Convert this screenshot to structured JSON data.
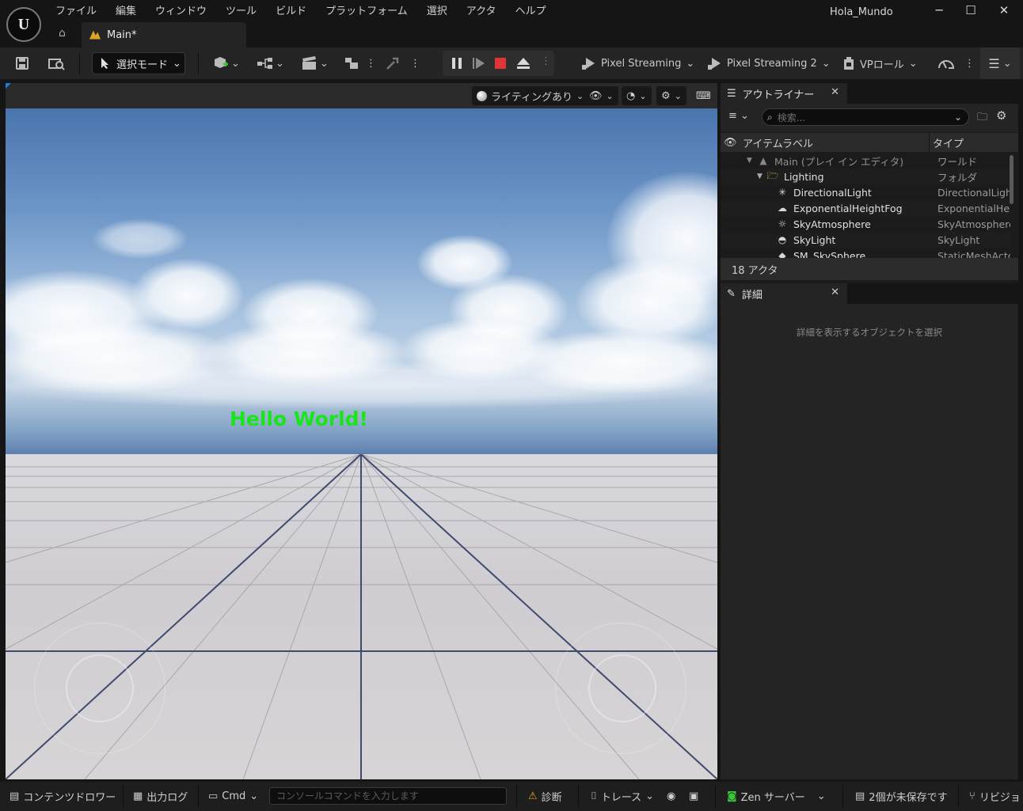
{
  "window": {
    "title": "Hola_Mundo",
    "minimize": "─",
    "maximize": "☐",
    "close": "✕"
  },
  "menu": [
    "ファイル",
    "編集",
    "ウィンドウ",
    "ツール",
    "ビルド",
    "プラットフォーム",
    "選択",
    "アクタ",
    "ヘルプ"
  ],
  "doc_tab": {
    "label": "Main*"
  },
  "toolbar": {
    "mode": "選択モード",
    "pixel_streaming": "Pixel Streaming",
    "pixel_streaming_2": "Pixel Streaming 2",
    "vp_role": "VPロール"
  },
  "viewport": {
    "lighting": "ライティングあり",
    "hello_text": "Hello World!"
  },
  "outliner": {
    "title": "アウトライナー",
    "search_placeholder": "検索...",
    "col_label": "アイテムラベル",
    "col_type": "タイプ",
    "rows": [
      {
        "name": "Main (プレイ イン エディタ)",
        "type": "ワールド",
        "icon": "level-icon"
      },
      {
        "name": "Lighting",
        "type": "フォルダ",
        "icon": "folder-icon"
      },
      {
        "name": "DirectionalLight",
        "type": "DirectionalLight",
        "icon": "directional-light-icon"
      },
      {
        "name": "ExponentialHeightFog",
        "type": "ExponentialHeig",
        "icon": "fog-icon"
      },
      {
        "name": "SkyAtmosphere",
        "type": "SkyAtmosphere",
        "icon": "sky-atmosphere-icon"
      },
      {
        "name": "SkyLight",
        "type": "SkyLight",
        "icon": "skylight-icon"
      },
      {
        "name": "SM_SkySphere",
        "type": "StaticMeshActo",
        "icon": "static-mesh-icon"
      }
    ],
    "count": "18 アクタ"
  },
  "details": {
    "title": "詳細",
    "empty_message": "詳細を表示するオブジェクトを選択"
  },
  "statusbar": {
    "content_drawer": "コンテンツドロワー",
    "output_log": "出力ログ",
    "cmd": "Cmd",
    "console_placeholder": "コンソールコマンドを入力します",
    "diagnostics": "診断",
    "trace": "トレース",
    "zen_server": "Zen サーバー",
    "unsaved": "2個が未保存です",
    "revision": "リビジョ"
  }
}
